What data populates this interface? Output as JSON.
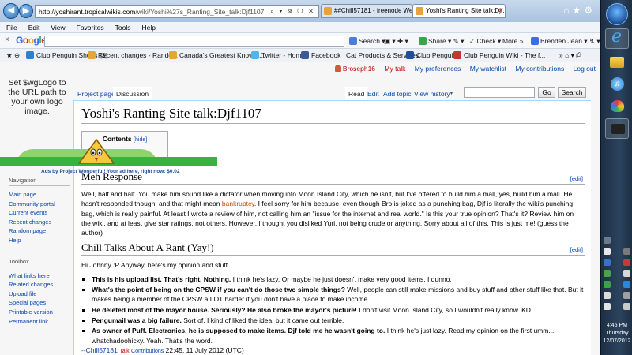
{
  "browser": {
    "url_domain": "http://yoshirant.tropicalwikis.com",
    "url_rest": "/wiki/Yoshi%27s_Ranting_Site_talk:Djf1107",
    "tabs": [
      {
        "label": "##Chill57181 - freenode Web I..."
      },
      {
        "label": "Yoshi's Ranting Site talk:Djf..."
      }
    ],
    "menu": [
      "File",
      "Edit",
      "View",
      "Favorites",
      "Tools",
      "Help"
    ],
    "google_toolbar": {
      "search_label": "Search",
      "share_label": "Share",
      "check_label": "Check",
      "more_label": "More",
      "user_label": "Brenden Jean"
    },
    "bookmarks": [
      "Club Penguin Shops (3)",
      "Recent changes - Rando...",
      "Canada's Greatest Know It...",
      "Twitter - Home",
      "Facebook",
      "Cat Products & Services",
      "Club Penguin",
      "Club Penguin Wiki - The f..."
    ]
  },
  "wiki": {
    "personal": {
      "user": "Broseph16",
      "talk": "My talk",
      "preferences": "My preferences",
      "watchlist": "My watchlist",
      "contributions": "My contributions",
      "logout": "Log out"
    },
    "logo_text": "Set $wgLogo to the URL path to your own logo image.",
    "tabs": {
      "project": "Project page",
      "discussion": "Discussion",
      "read": "Read",
      "edit": "Edit",
      "add_topic": "Add topic",
      "history": "View history"
    },
    "search": {
      "go": "Go",
      "search": "Search"
    },
    "title": "Yoshi's Ranting Site talk:Djf1107",
    "toc": {
      "title": "Contents",
      "hide": "[hide]"
    },
    "ad_caption": "Ads by Project Wonderful! Your ad here, right now: $0.02",
    "edit_label": "[edit]",
    "sections": [
      {
        "heading": "Meh Response",
        "p1": "Well, half and half. You make him sound like a dictator when moving into Moon Island City, which he isn't, but I've offered to build him a mall, yes, build him a mall. He hasn't responded though, and that might mean ",
        "link": "bankruptcy",
        "p2": ". I feel sorry for him because, even though Bro is joked as a punching bag, Djf is literally the wiki's punching bag, which is really painful. At least I wrote a review of him, not calling him an \"issue for the internet and real world.\" Is this your true opinion? That's it? Review him on the wiki, and at least give star ratings, not others. However, I thought you disliked Yuri, not being crude or anything. Sorry about all of this. This is just me! (guess the author)"
      },
      {
        "heading": "Chill Talks About A Rant (Yay!)",
        "intro": "Hi Johnny :P Anyway, here's my opinion and stuff.",
        "bullets": [
          {
            "bold": "This is his upload list. That's right. Nothing.",
            "text": " I think he's lazy. Or maybe he just doesn't make very good items. I dunno."
          },
          {
            "bold": "What's the point of being on the CPSW if you can't do those two simple things?",
            "text": " Well, people can still make missions and buy stuff and other stuff like that. But it makes being a member of the CPSW a LOT harder if you don't have a place to make income."
          },
          {
            "bold": "He deleted most of the mayor house. Seriously? He also broke the mayor's picture!",
            "text": " I don't visit Moon Island City, so I wouldn't really know. KD"
          },
          {
            "bold": "Pengumail was a big failure.",
            "text": " Sort of. I kind of liked the idea, but it came out terrible."
          },
          {
            "bold": "As owner of Puff. Electronics, he is supposed to make items. Djf told me he wasn't going to.",
            "text": " I think he's just lazy. Read my opinion on the first umm... whatchadoohicky. Yeah. That's the word."
          }
        ],
        "sig_user": "--Chill57181",
        "sig_talk": "Talk",
        "sig_contribs": "Contributions",
        "sig_time": "22:45, 11 July 2012 (UTC)"
      }
    ],
    "sidebar": {
      "navigation_heading": "Navigation",
      "navigation": [
        "Main page",
        "Community portal",
        "Current events",
        "Recent changes",
        "Random page",
        "Help"
      ],
      "toolbox_heading": "Toolbox",
      "toolbox": [
        "What links here",
        "Related changes",
        "Upload file",
        "Special pages",
        "Printable version",
        "Permanent link"
      ]
    }
  },
  "taskbar": {
    "time": "4:45 PM",
    "day": "Thursday",
    "date": "12/07/2012"
  },
  "colors": {
    "link": "#0645ad",
    "redlink": "#ba0000",
    "taskbar": "#1d2f43"
  }
}
